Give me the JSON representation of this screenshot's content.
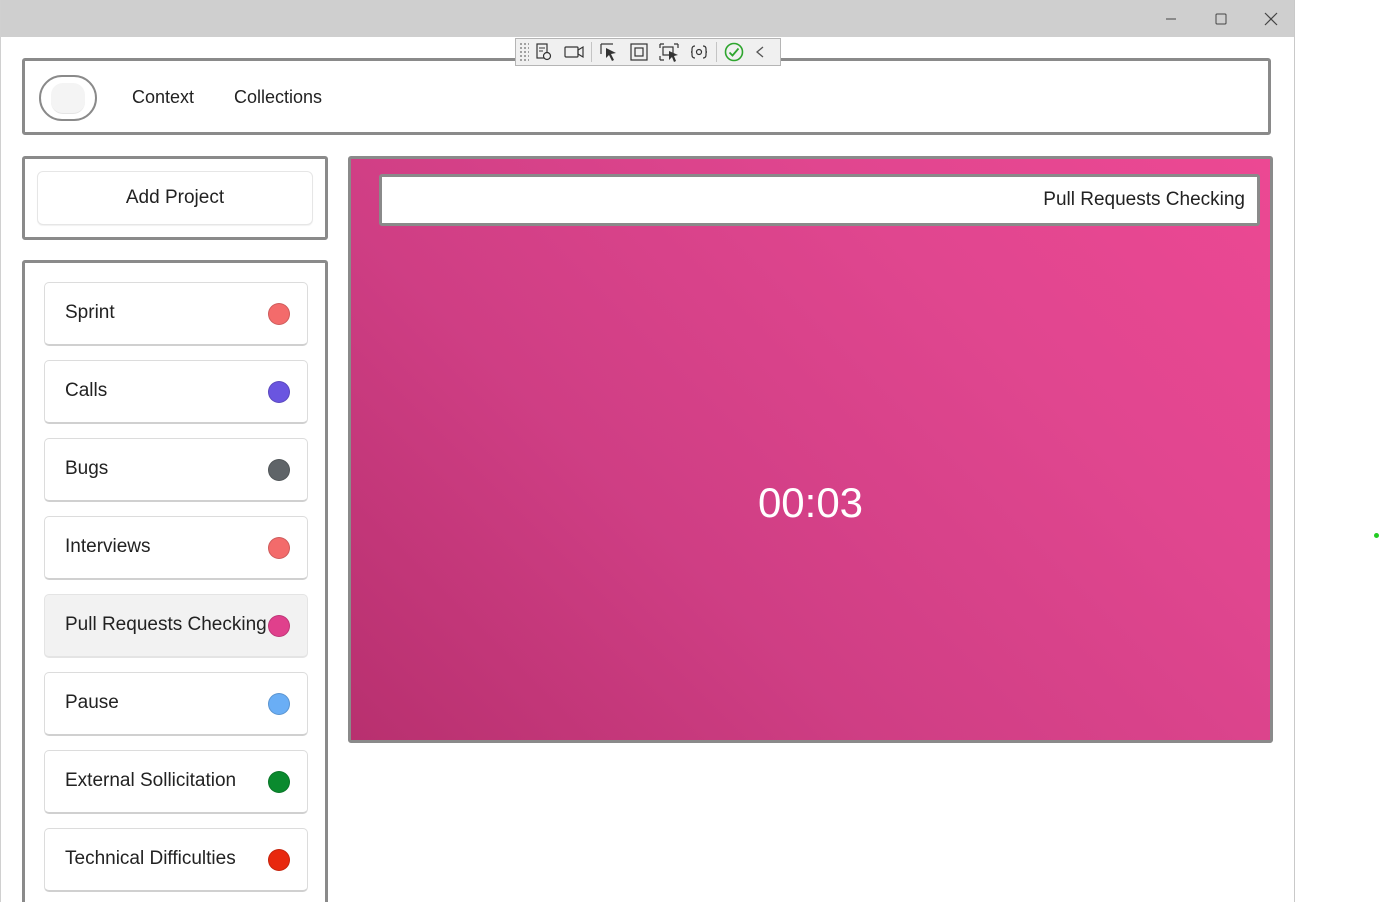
{
  "window": {
    "controls": [
      "minimize-icon",
      "maximize-icon",
      "close-icon"
    ]
  },
  "debug_toolbar": {
    "icons": [
      "live-visual-tree-icon",
      "record-icon",
      "select-element-icon",
      "display-layout-adorners-icon",
      "track-focused-element-icon",
      "binding-failures-icon",
      "hot-reload-ok-icon",
      "collapse-chevron-icon"
    ],
    "status_color": "#2ea52e"
  },
  "nav": {
    "links": [
      {
        "label": "Context"
      },
      {
        "label": "Collections"
      }
    ]
  },
  "sidebar": {
    "add_project_label": "Add Project",
    "projects": [
      {
        "label": "Sprint",
        "color": "#f36b6b"
      },
      {
        "label": "Calls",
        "color": "#6a55e0"
      },
      {
        "label": "Bugs",
        "color": "#5f6468"
      },
      {
        "label": "Interviews",
        "color": "#f36b6b"
      },
      {
        "label": "Pull Requests Checking",
        "color": "#e0408c",
        "selected": true
      },
      {
        "label": "Pause",
        "color": "#6aaef5"
      },
      {
        "label": "External Sollicitation",
        "color": "#0a8a2e"
      },
      {
        "label": "Technical Difficulties",
        "color": "#e8280e"
      }
    ]
  },
  "main": {
    "current_project": "Pull Requests Checking",
    "timer": "00:03",
    "accent_color": "#e0408c"
  }
}
